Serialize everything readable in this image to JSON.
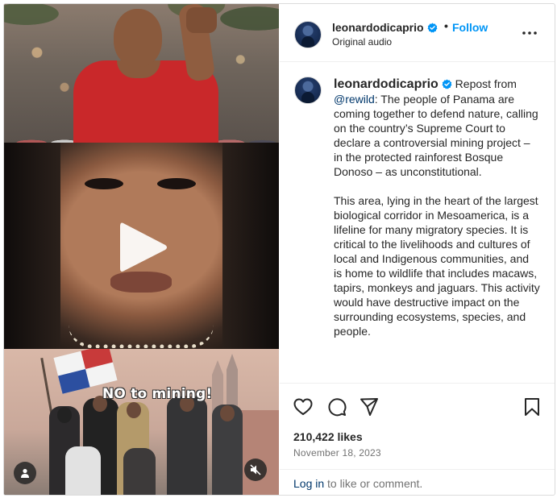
{
  "post": {
    "username": "leonardodicaprio",
    "follow_label": "Follow",
    "separator": "•",
    "audio": "Original audio",
    "caption_username": "leonardodicaprio",
    "caption_part1": " Repost from ",
    "mention": "@rewild",
    "caption_part2": ": The people of Panama are coming together to defend nature, calling on the country’s Supreme Court to declare a controversial mining project – in the protected rainforest Bosque Donoso – as unconstitutional.\n\nThis area, lying in the heart of the largest biological corridor in Mesoamerica, is a lifeline for many migratory species. It is critical to the livelihoods and cultures of local and Indigenous communities, and is home to wildlife that includes macaws, tapirs, monkeys and jaguars. This activity would have destructive impact on the surrounding ecosystems, species, and people.",
    "likes": "210,422 likes",
    "date": "November 18, 2023",
    "login_link": "Log in",
    "login_rest": " to like or comment."
  },
  "media": {
    "slogan": "NO to mining!"
  },
  "icons": {
    "verified": "verified-badge-icon",
    "more": "more-options-icon",
    "like": "heart-icon",
    "comment": "comment-icon",
    "share": "paper-plane-icon",
    "save": "bookmark-icon",
    "play": "play-icon",
    "user_tag": "person-icon",
    "mute": "speaker-muted-icon"
  },
  "colors": {
    "follow": "#0095f6",
    "verified": "#0095f6",
    "link": "#00376b",
    "muted_text": "#737373"
  }
}
